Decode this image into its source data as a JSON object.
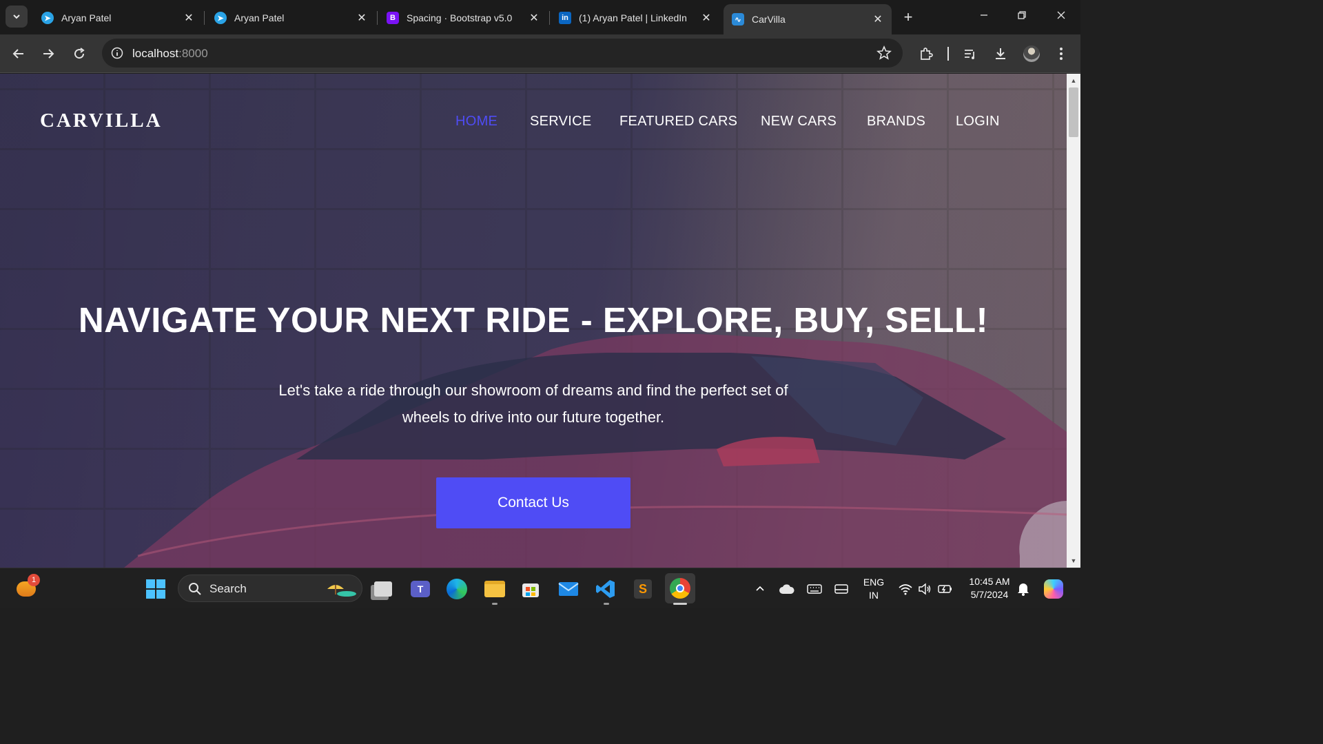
{
  "browser": {
    "tabs": [
      {
        "title": "Aryan Patel",
        "favicon": "telegram-icon",
        "color": "#2aa3e6"
      },
      {
        "title": "Aryan Patel",
        "favicon": "telegram-icon",
        "color": "#2aa3e6"
      },
      {
        "title": "Spacing · Bootstrap v5.0",
        "favicon": "bootstrap-icon",
        "color": "#7a12f5"
      },
      {
        "title": "(1) Aryan Patel | LinkedIn",
        "favicon": "linkedin-icon",
        "color": "#0a66c2"
      },
      {
        "title": "CarVilla",
        "favicon": "carvilla-icon",
        "color": "#2b8ad8",
        "active": true
      }
    ],
    "url_host": "localhost",
    "url_port": ":8000"
  },
  "site": {
    "brand": "CARVILLA",
    "nav": [
      "HOME",
      "SERVICE",
      "FEATURED CARS",
      "NEW CARS",
      "BRANDS",
      "LOGIN"
    ],
    "active_nav": "HOME",
    "hero_title": "NAVIGATE YOUR NEXT RIDE - EXPLORE, BUY, SELL!",
    "hero_subtitle_line1": "Let's take a ride through our showroom of dreams and find the perfect set of",
    "hero_subtitle_line2": "wheels to drive into our future together.",
    "cta_label": "Contact Us",
    "accent": "#4f4cf5"
  },
  "taskbar": {
    "search_label": "Search",
    "weather_badge": "1",
    "lang_line1": "ENG",
    "lang_line2": "IN",
    "time": "10:45 AM",
    "date": "5/7/2024"
  }
}
